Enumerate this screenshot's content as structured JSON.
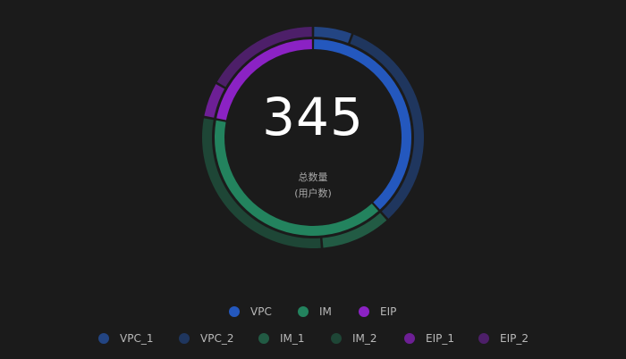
{
  "chart_data": {
    "type": "pie",
    "subtype": "nested-donut",
    "center": {
      "value": "345",
      "label": "总数量",
      "sublabel": "(用户数)"
    },
    "inner_series": [
      {
        "name": "VPC",
        "value": 132,
        "color": "#2458be"
      },
      {
        "name": "IM",
        "value": 137,
        "color": "#23835e"
      },
      {
        "name": "EIP",
        "value": 76,
        "color": "#8b22c4"
      }
    ],
    "outer_series": [
      {
        "name": "VPC_1",
        "value": 20,
        "color": "#234583"
      },
      {
        "name": "VPC_2",
        "value": 112,
        "color": "#1f365e"
      },
      {
        "name": "IM_1",
        "value": 36,
        "color": "#225b44"
      },
      {
        "name": "IM_2",
        "value": 101,
        "color": "#1e4636"
      },
      {
        "name": "EIP_1",
        "value": 18,
        "color": "#6d1f95"
      },
      {
        "name": "EIP_2",
        "value": 58,
        "color": "#4d1f69"
      }
    ],
    "legend_position": "bottom-center"
  }
}
